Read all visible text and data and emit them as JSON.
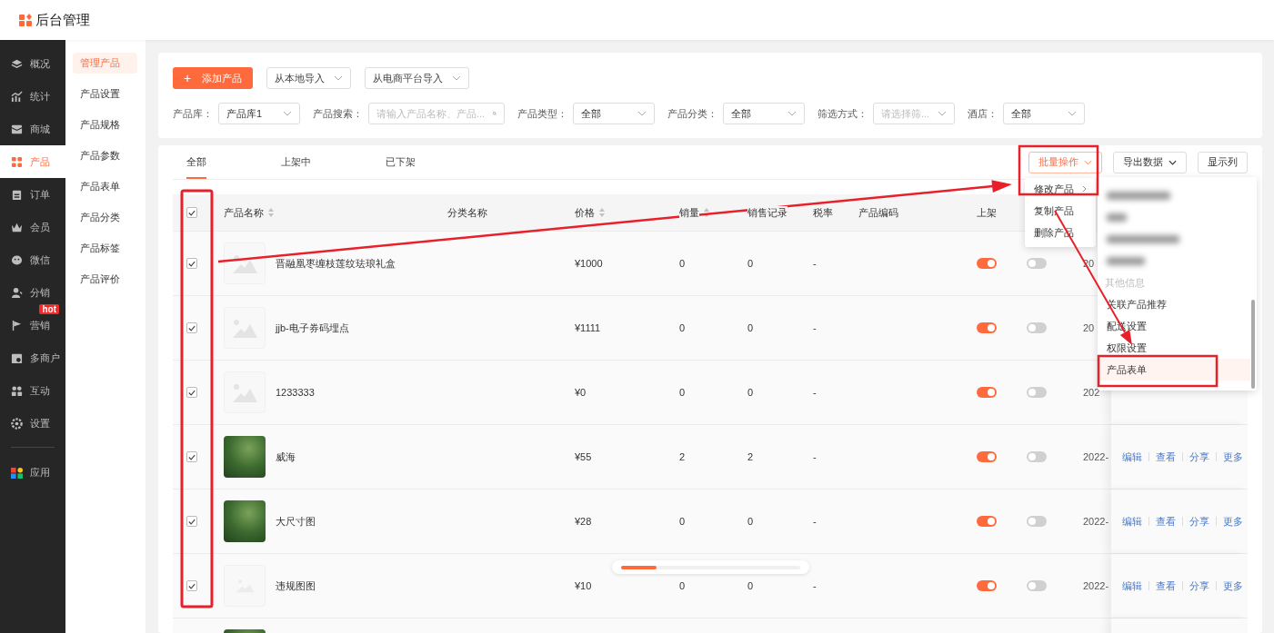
{
  "header": {
    "title": "后台管理"
  },
  "nav": [
    {
      "label": "概况",
      "selected": false
    },
    {
      "label": "统计",
      "selected": false
    },
    {
      "label": "商城",
      "selected": false
    },
    {
      "label": "产品",
      "selected": true
    },
    {
      "label": "订单",
      "selected": false
    },
    {
      "label": "会员",
      "selected": false
    },
    {
      "label": "微信",
      "selected": false
    },
    {
      "label": "分销",
      "selected": false
    },
    {
      "label": "营销",
      "selected": false,
      "badge": "hot"
    },
    {
      "label": "多商户",
      "selected": false
    },
    {
      "label": "互动",
      "selected": false
    },
    {
      "label": "设置",
      "selected": false
    }
  ],
  "nav_apps": {
    "label": "应用",
    "selected": false
  },
  "subnav": [
    {
      "label": "管理产品",
      "selected": true
    },
    {
      "label": "产品设置",
      "selected": false
    },
    {
      "label": "产品规格",
      "selected": false
    },
    {
      "label": "产品参数",
      "selected": false
    },
    {
      "label": "产品表单",
      "selected": false
    },
    {
      "label": "产品分类",
      "selected": false
    },
    {
      "label": "产品标签",
      "selected": false
    },
    {
      "label": "产品评价",
      "selected": false
    }
  ],
  "toolbar": {
    "add_button": {
      "icon": "+",
      "label": "添加产品"
    },
    "imports": [
      {
        "label": "从本地导入"
      },
      {
        "label": "从电商平台导入"
      }
    ]
  },
  "filters": [
    {
      "label": "产品库：",
      "value": "产品库1",
      "kind": "select"
    },
    {
      "label": "产品搜索：",
      "placeholder": "请输入产品名称、产品...",
      "kind": "search"
    },
    {
      "label": "产品类型：",
      "value": "全部",
      "kind": "select"
    },
    {
      "label": "产品分类：",
      "value": "全部",
      "kind": "select"
    },
    {
      "label": "筛选方式：",
      "placeholder": "请选择筛...",
      "kind": "select"
    },
    {
      "label": "酒店：",
      "value": "全部",
      "kind": "select"
    }
  ],
  "tabs": [
    {
      "label": "全部",
      "selected": true
    },
    {
      "label": "上架中",
      "selected": false
    },
    {
      "label": "已下架",
      "selected": false
    }
  ],
  "table_actions": {
    "batch": {
      "label": "批量操作",
      "open": true
    },
    "export": {
      "label": "导出数据"
    },
    "columns": {
      "label": "显示列"
    }
  },
  "batch_menu": [
    {
      "label": "修改产品",
      "submenu": true
    },
    {
      "label": "复制产品",
      "submenu": false
    },
    {
      "label": "删除产品",
      "submenu": false
    }
  ],
  "submenu": {
    "group_label": "其他信息",
    "items": [
      {
        "label": "关联产品推荐",
        "selected": false
      },
      {
        "label": "配送设置",
        "selected": false
      },
      {
        "label": "权限设置",
        "selected": false
      },
      {
        "label": "产品表单",
        "selected": true
      }
    ]
  },
  "table": {
    "all_checked": true,
    "columns": [
      {
        "label": "产品名称",
        "sortable": true
      },
      {
        "label": "分类名称",
        "sortable": false
      },
      {
        "label": "价格",
        "sortable": true
      },
      {
        "label": "销量",
        "sortable": true
      },
      {
        "label": "销售记录",
        "sortable": false
      },
      {
        "label": "税率",
        "sortable": false
      },
      {
        "label": "产品编码",
        "sortable": false
      },
      {
        "label": "上架",
        "sortable": false
      }
    ],
    "rows": [
      {
        "checked": true,
        "kind": "placeholder",
        "name": "晋融凰枣缠枝莲纹珐琅礼盒",
        "price": "¥1000",
        "sales": "0",
        "records": "0",
        "tax": "-",
        "listed": true,
        "switch_2": false,
        "date": "20"
      },
      {
        "checked": true,
        "kind": "placeholder",
        "name": "jjb-电子券码埋点",
        "price": "¥1111",
        "sales": "0",
        "records": "0",
        "tax": "-",
        "listed": true,
        "switch_2": false,
        "date": "20"
      },
      {
        "checked": true,
        "kind": "placeholder",
        "name": "1233333",
        "price": "¥0",
        "sales": "0",
        "records": "0",
        "tax": "-",
        "listed": true,
        "switch_2": false,
        "date": "202"
      },
      {
        "checked": true,
        "kind": "photo",
        "name": "威海",
        "price": "¥55",
        "sales": "2",
        "records": "2",
        "tax": "-",
        "listed": true,
        "switch_2": false,
        "date": "2022-",
        "actions": [
          "编辑",
          "查看",
          "分享",
          "更多"
        ]
      },
      {
        "checked": true,
        "kind": "photo",
        "name": "大尺寸图",
        "price": "¥28",
        "sales": "0",
        "records": "0",
        "tax": "-",
        "listed": true,
        "switch_2": false,
        "date": "2022-",
        "actions": [
          "编辑",
          "查看",
          "分享",
          "更多"
        ]
      },
      {
        "checked": true,
        "kind": "missing",
        "name": "违规图图",
        "price": "¥10",
        "sales": "0",
        "records": "0",
        "tax": "-",
        "listed": true,
        "switch_2": false,
        "date": "2022-",
        "actions": [
          "编辑",
          "查看",
          "分享",
          "更多"
        ]
      },
      {
        "kind": "photo"
      }
    ]
  },
  "loading_bar": {
    "level": 0.2
  }
}
